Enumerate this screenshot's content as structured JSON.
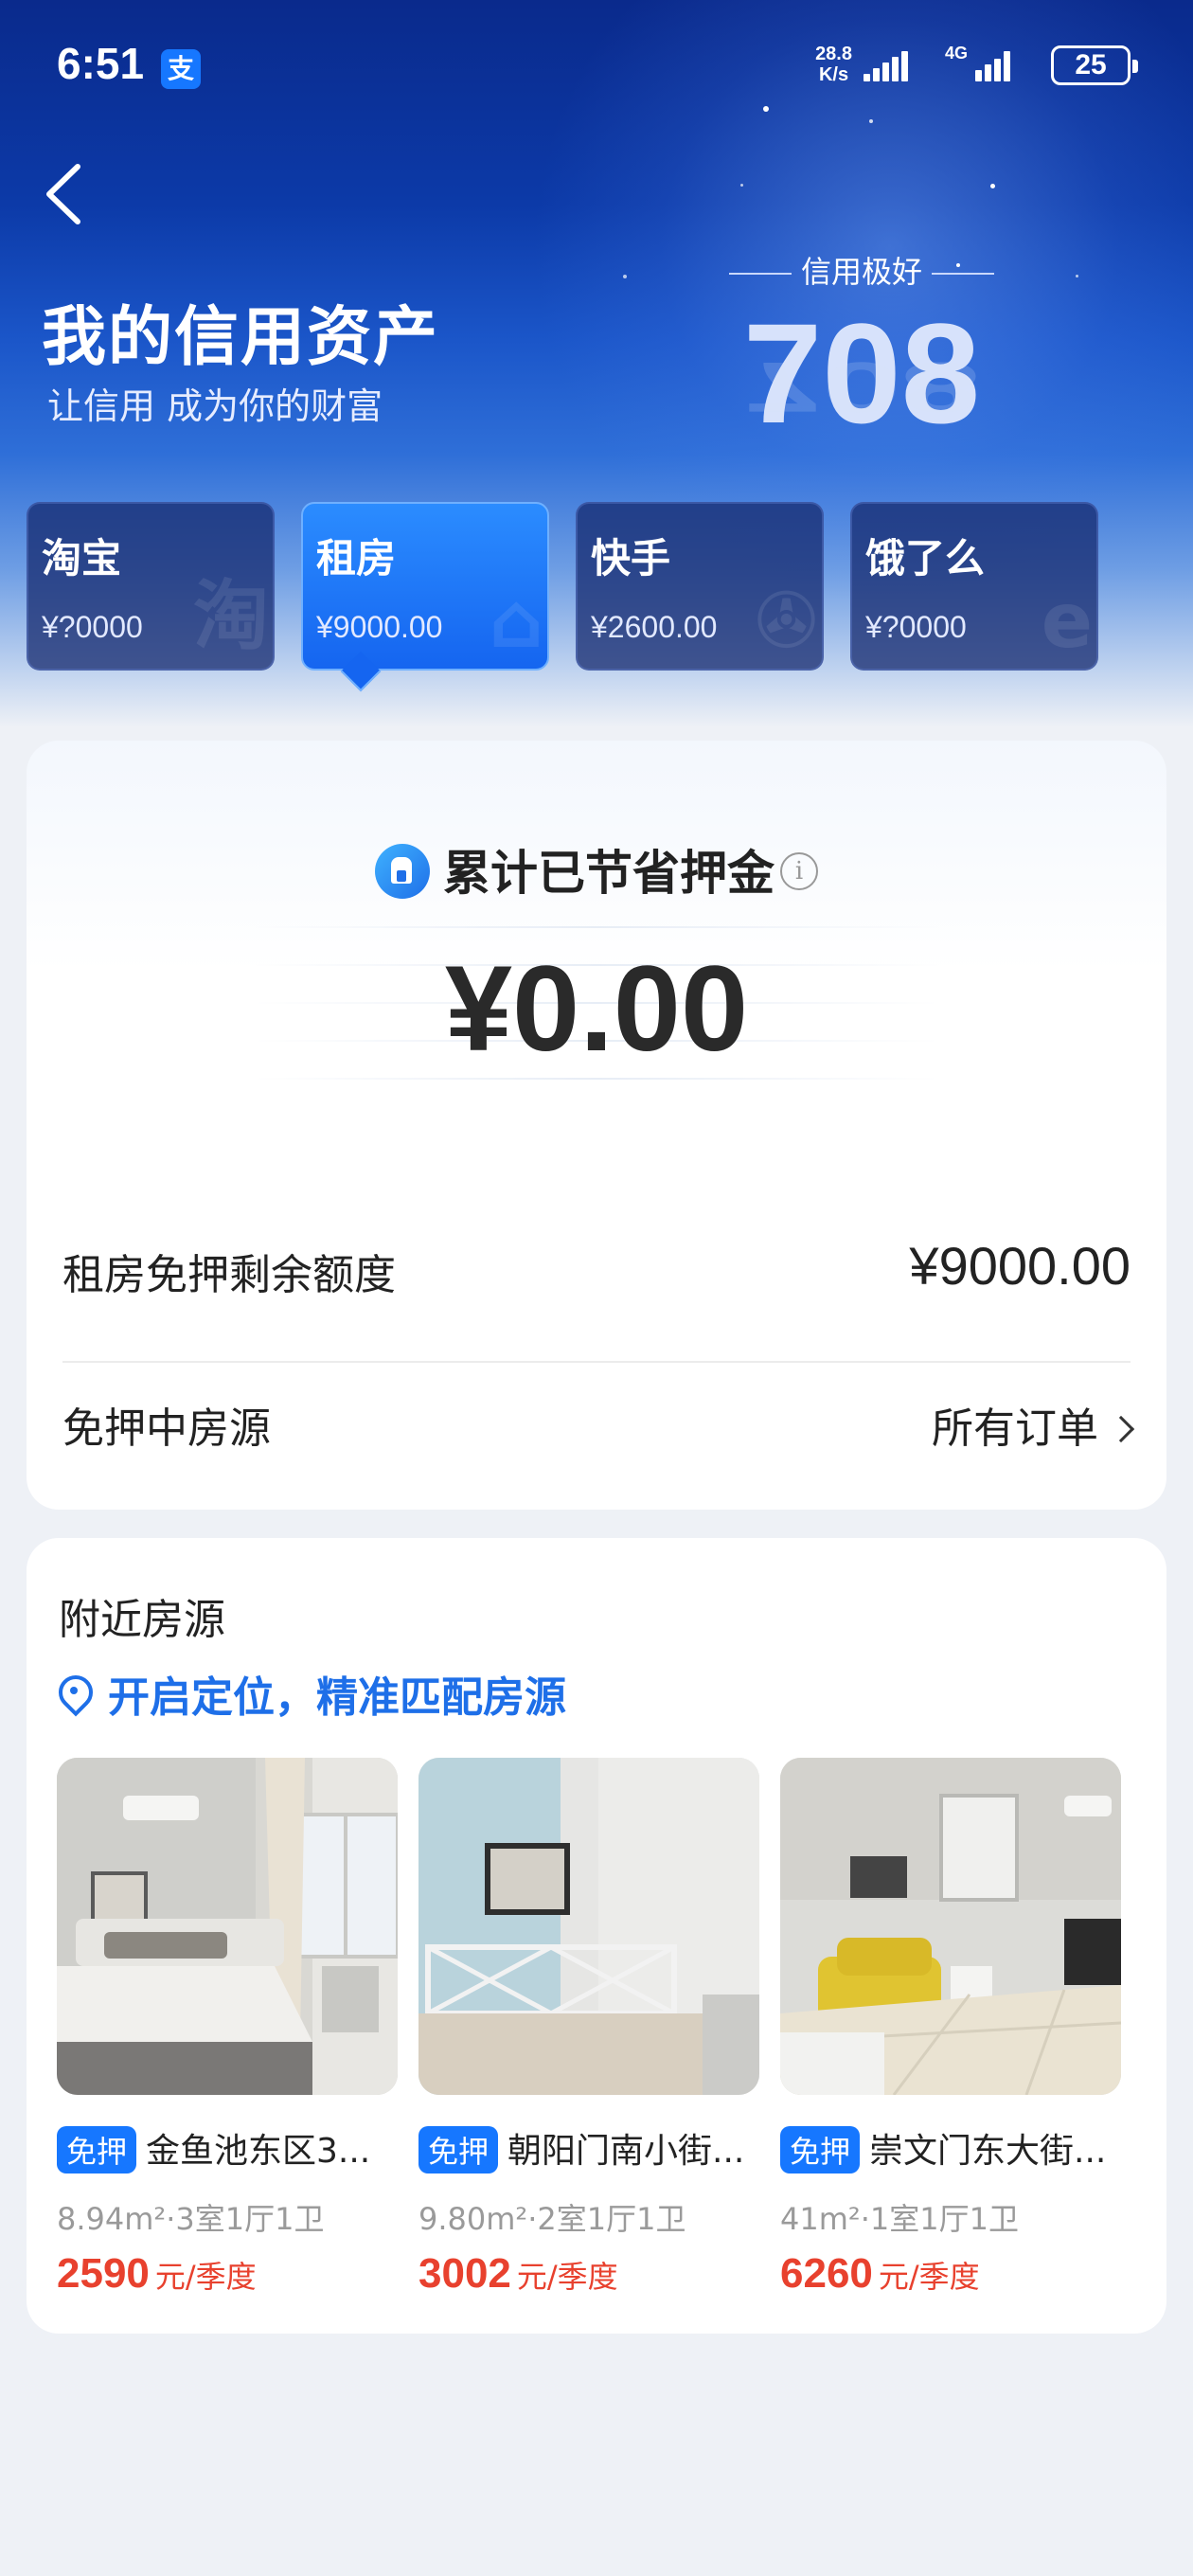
{
  "status_bar": {
    "time": "6:51",
    "app_badge": "支",
    "net_speed_value": "28.8",
    "net_speed_unit": "K/s",
    "network_type": "4G",
    "battery": "25"
  },
  "header": {
    "title": "我的信用资产",
    "subtitle": "让信用 成为你的财富",
    "credit_level": "信用极好",
    "credit_score": "708"
  },
  "asset_tabs": [
    {
      "name": "淘宝",
      "amount": "¥?0000",
      "bg_glyph": "淘",
      "active": false
    },
    {
      "name": "租房",
      "amount": "¥9000.00",
      "bg_glyph": "⌂",
      "active": true
    },
    {
      "name": "快手",
      "amount": "¥2600.00",
      "bg_glyph": "✇",
      "active": false
    },
    {
      "name": "饿了么",
      "amount": "¥?0000",
      "bg_glyph": "e",
      "active": false
    }
  ],
  "deposit_card": {
    "heading": "累计已节省押金",
    "info_icon": "i",
    "saved_amount": "¥0.00",
    "quota_label": "租房免押剩余额度",
    "quota_value": "¥9000.00",
    "houses_label": "免押中房源",
    "all_orders_label": "所有订单"
  },
  "nearby": {
    "title": "附近房源",
    "locate_label": "开启定位，精准匹配房源",
    "listings": [
      {
        "badge": "免押",
        "title": "金鱼池东区3...",
        "spec": "8.94m²·3室1厅1卫",
        "price": "2590",
        "unit": "元/季度"
      },
      {
        "badge": "免押",
        "title": "朝阳门南小街...",
        "spec": "9.80m²·2室1厅1卫",
        "price": "3002",
        "unit": "元/季度"
      },
      {
        "badge": "免押",
        "title": "崇文门东大街...",
        "spec": "41m²·1室1厅1卫",
        "price": "6260",
        "unit": "元/季度"
      }
    ]
  }
}
